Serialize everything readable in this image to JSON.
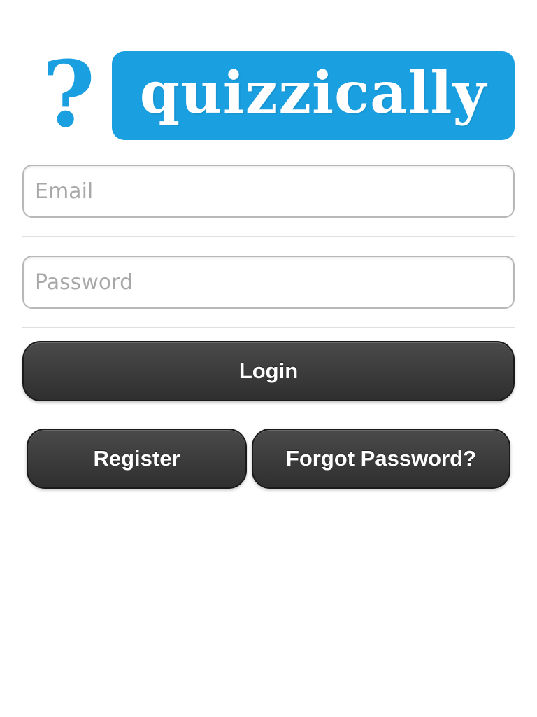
{
  "logo": {
    "question_mark": "?",
    "text": "quizzically",
    "brand_color": "#1a9fe0"
  },
  "form": {
    "email": {
      "value": "",
      "placeholder": "Email"
    },
    "password": {
      "value": "",
      "placeholder": "Password"
    },
    "login_label": "Login",
    "register_label": "Register",
    "forgot_label": "Forgot Password?"
  },
  "colors": {
    "button_bg": "#3a3a3a",
    "button_text": "#ffffff",
    "placeholder": "#a8a8a8"
  }
}
